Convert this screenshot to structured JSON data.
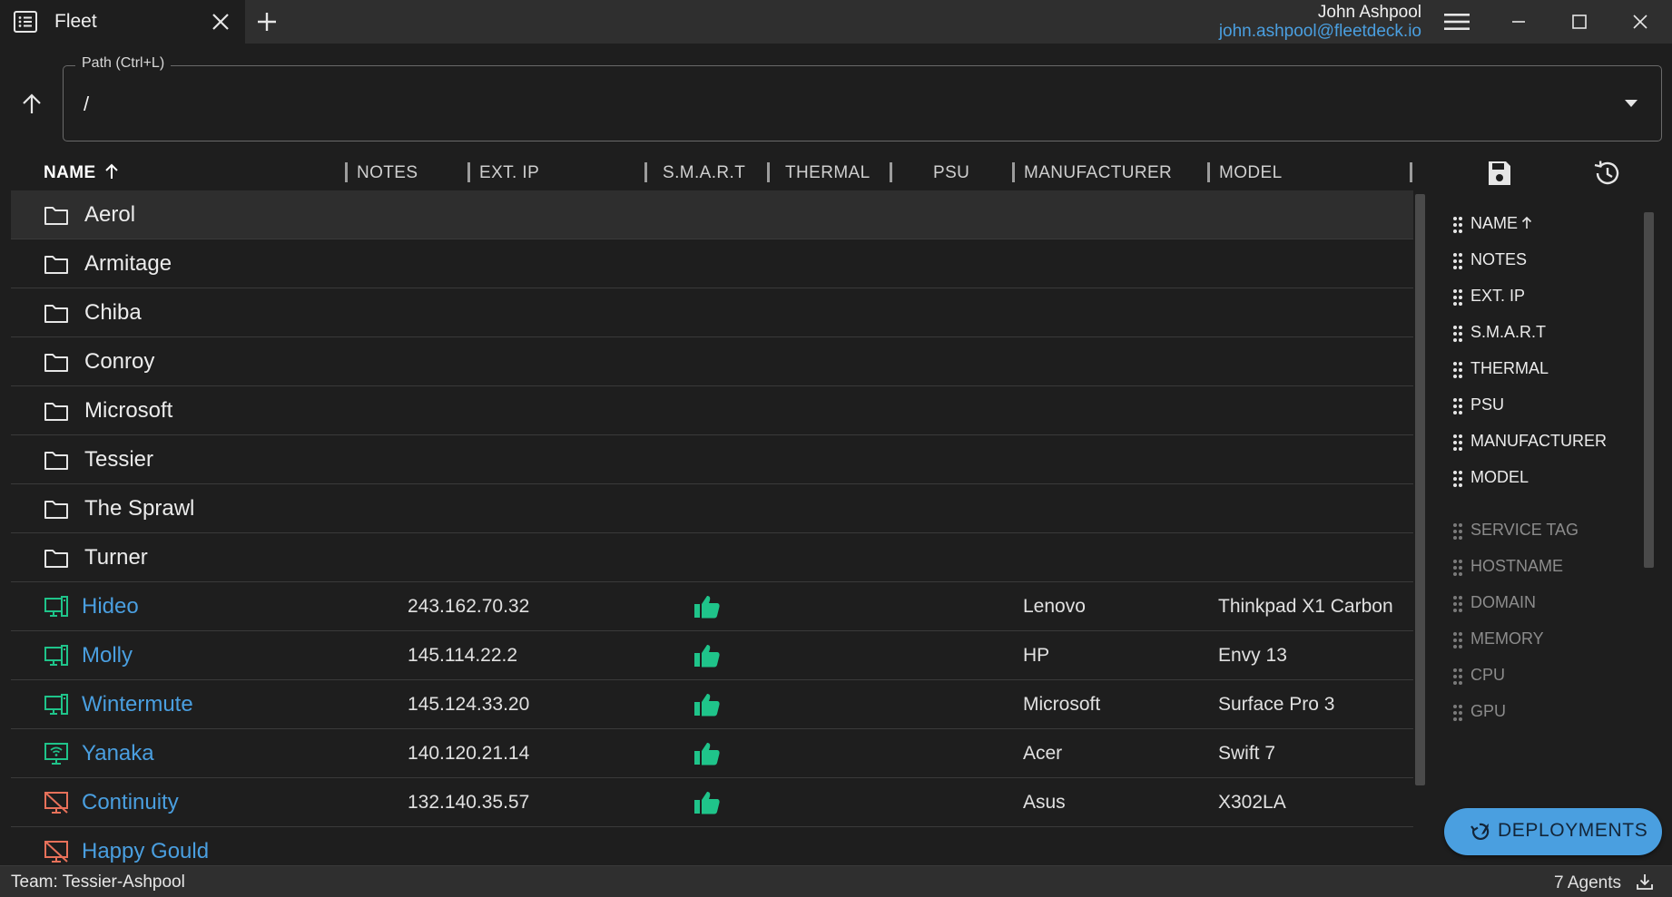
{
  "window": {
    "tab_title": "Fleet",
    "user_name": "John Ashpool",
    "user_email": "john.ashpool@fleetdeck.io"
  },
  "path": {
    "label": "Path (Ctrl+L)",
    "value": "/"
  },
  "table": {
    "columns": [
      "NAME",
      "NOTES",
      "EXT. IP",
      "S.M.A.R.T",
      "THERMAL",
      "PSU",
      "MANUFACTURER",
      "MODEL"
    ],
    "sort_column": "NAME",
    "sort_direction": "ascending",
    "folders": [
      "Aerol",
      "Armitage",
      "Chiba",
      "Conroy",
      "Microsoft",
      "Tessier",
      "The Sprawl",
      "Turner"
    ],
    "agents": [
      {
        "name": "Hideo",
        "ext_ip": "243.162.70.32",
        "smart": "thumbs-up-icon",
        "manufacturer": "Lenovo",
        "model": "Thinkpad X1 Carbon",
        "status": "online"
      },
      {
        "name": "Molly",
        "ext_ip": "145.114.22.2",
        "smart": "thumbs-up-icon",
        "manufacturer": "HP",
        "model": "Envy 13",
        "status": "online"
      },
      {
        "name": "Wintermute",
        "ext_ip": "145.124.33.20",
        "smart": "thumbs-up-icon",
        "manufacturer": "Microsoft",
        "model": "Surface Pro 3",
        "status": "online"
      },
      {
        "name": "Yanaka",
        "ext_ip": "140.120.21.14",
        "smart": "thumbs-up-icon",
        "manufacturer": "Acer",
        "model": "Swift 7",
        "status": "wifi"
      },
      {
        "name": "Continuity",
        "ext_ip": "132.140.35.57",
        "smart": "thumbs-up-icon",
        "manufacturer": "Asus",
        "model": "X302LA",
        "status": "offline"
      },
      {
        "name": "Happy Gould",
        "ext_ip": "",
        "smart": "",
        "manufacturer": "",
        "model": "",
        "status": "offline"
      }
    ]
  },
  "column_panel": {
    "visible": [
      "NAME",
      "NOTES",
      "EXT. IP",
      "S.M.A.R.T",
      "THERMAL",
      "PSU",
      "MANUFACTURER",
      "MODEL"
    ],
    "hidden": [
      "SERVICE TAG",
      "HOSTNAME",
      "DOMAIN",
      "MEMORY",
      "CPU",
      "GPU"
    ]
  },
  "deploy_button": "DEPLOYMENTS",
  "status": {
    "team": "Team: Tessier-Ashpool",
    "agents": "7 Agents"
  },
  "colors": {
    "accent": "#4a9fe0",
    "online": "#1fc48a",
    "offline": "#e8715a",
    "background": "#1e1e1e",
    "titlebar": "#2f2f2f"
  }
}
